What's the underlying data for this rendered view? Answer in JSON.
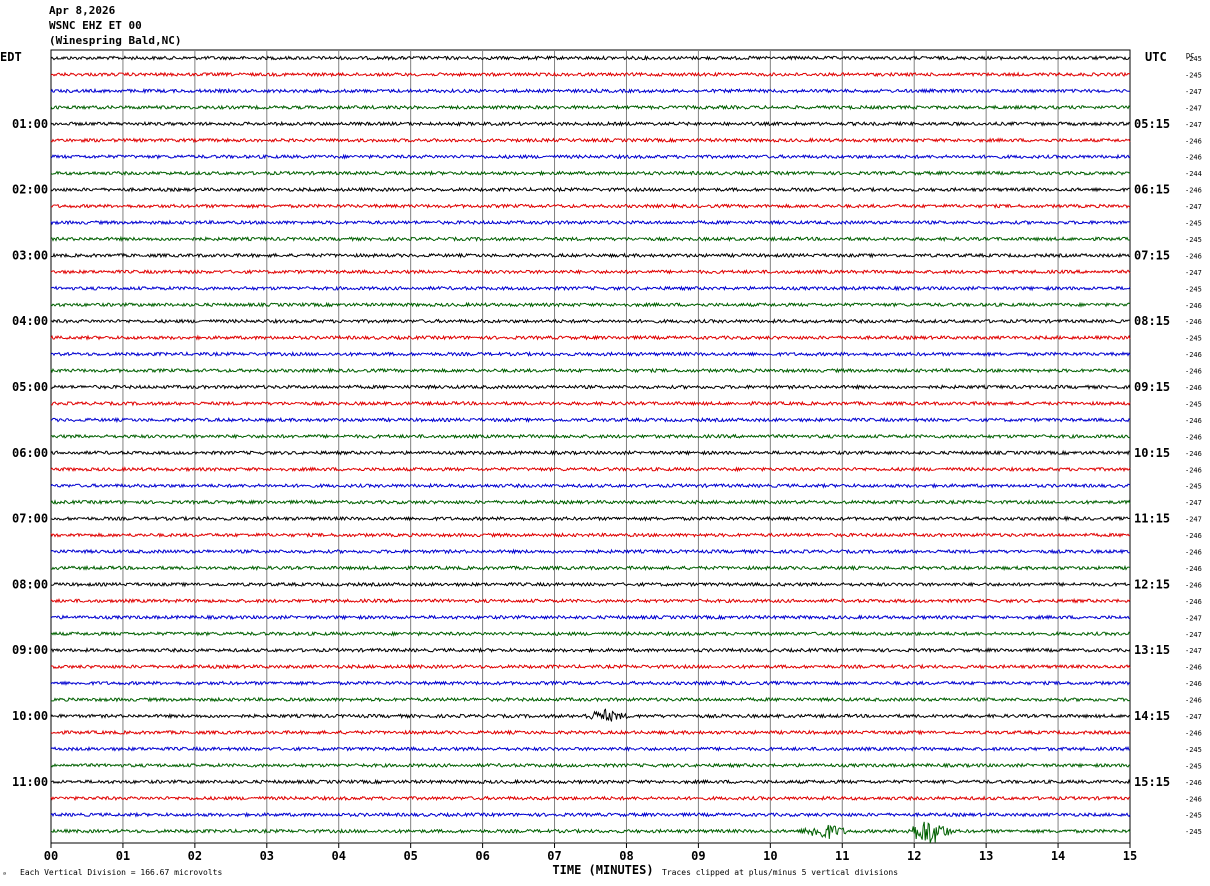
{
  "header": {
    "date": "Apr 8,2026",
    "station": "WSNC EHZ ET 00",
    "location": "(Winespring Bald,NC)"
  },
  "chart_data": {
    "type": "line",
    "title": "Apr 8,2026 WSNC EHZ ET 00 (Winespring Bald,NC)",
    "left_axis_label": "EDT",
    "right_axis_label": "UTC",
    "dc_label": "DC",
    "xlabel": "TIME (MINUTES)",
    "x_ticks": [
      "00",
      "01",
      "02",
      "03",
      "04",
      "05",
      "06",
      "07",
      "08",
      "09",
      "10",
      "11",
      "12",
      "13",
      "14",
      "15"
    ],
    "xlim": [
      0,
      15
    ],
    "grid": true,
    "left_time_labels": [
      "01:00",
      "02:00",
      "03:00",
      "04:00",
      "05:00",
      "06:00",
      "07:00",
      "08:00",
      "09:00",
      "10:00",
      "11:00"
    ],
    "right_time_labels": [
      "05:15",
      "06:15",
      "07:15",
      "08:15",
      "09:15",
      "10:15",
      "11:15",
      "12:15",
      "13:15",
      "14:15",
      "15:15"
    ],
    "trace_colors": [
      "#000000",
      "#e00000",
      "#0000d0",
      "#006000"
    ],
    "dc_offsets": [
      "-245",
      "-245",
      "-247",
      "-247",
      "-247",
      "-246",
      "-246",
      "-244",
      "-246",
      "-247",
      "-245",
      "-245",
      "-246",
      "-247",
      "-245",
      "-246",
      "-246",
      "-245",
      "-246",
      "-246",
      "-246",
      "-245",
      "-246",
      "-246",
      "-246",
      "-246",
      "-245",
      "-247",
      "-247",
      "-246",
      "-246",
      "-246",
      "-246",
      "-246",
      "-247",
      "-247",
      "-247",
      "-246",
      "-246",
      "-246",
      "-247",
      "-246",
      "-245",
      "-245",
      "-246",
      "-246",
      "-245",
      "-245"
    ],
    "events": [
      {
        "row": 40,
        "minute": 7.7,
        "amplitude": 2.2
      },
      {
        "row": 47,
        "minute": 10.75,
        "amplitude": 3.2
      },
      {
        "row": 47,
        "minute": 12.2,
        "amplitude": 5.5
      }
    ],
    "bottom_notes": {
      "left": "Each Vertical Division =  166.67 microvolts",
      "right": "Traces clipped at plus/minus 5 vertical divisions"
    }
  }
}
